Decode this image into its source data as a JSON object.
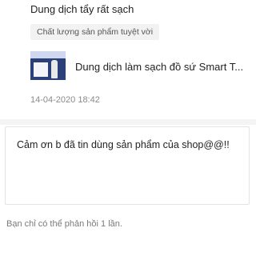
{
  "review": {
    "title": "Dung dịch tẩy rất sạch",
    "tag": "Chất lượng sản phẩm tuyệt vời",
    "timestamp": "14-04-2020 18:42"
  },
  "product": {
    "name": "Dung dịch làm sạch đồ sứ Smart T...",
    "thumbnail_icon": "product-thumbnail-image"
  },
  "reply": {
    "text": "Cảm ơn b đã tin dùng sản phẩm của shop@@!!",
    "note": "Bạn chỉ có thể phản hồi 1 lần."
  },
  "colors": {
    "text_primary": "#222222",
    "text_secondary": "#8a8a8a",
    "tag_background": "#f2f2f2",
    "divider": "#f4f4f4"
  }
}
